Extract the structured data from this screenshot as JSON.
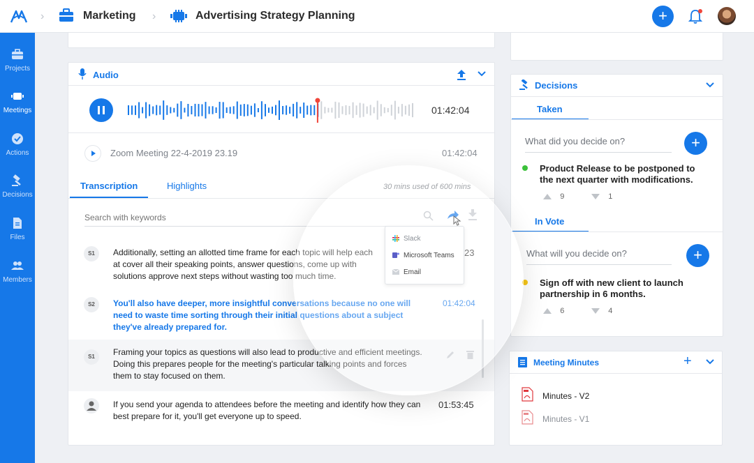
{
  "breadcrumb": {
    "item1": "Marketing",
    "item2": "Advertising Strategy Planning"
  },
  "sidebar": {
    "items": [
      {
        "label": "Projects",
        "icon": "briefcase-icon"
      },
      {
        "label": "Meetings",
        "icon": "meeting-icon"
      },
      {
        "label": "Actions",
        "icon": "check-circle-icon"
      },
      {
        "label": "Decisions",
        "icon": "gavel-icon"
      },
      {
        "label": "Files",
        "icon": "file-icon"
      },
      {
        "label": "Members",
        "icon": "members-icon"
      }
    ]
  },
  "audio": {
    "title": "Audio",
    "duration": "01:42:04",
    "recording": {
      "name": "Zoom Meeting 22-4-2019 23.19",
      "time": "01:42:04"
    },
    "progress": 0.66
  },
  "transcription": {
    "tabs": [
      "Transcription",
      "Highlights"
    ],
    "usage": "30 mins used of 600 mins",
    "search_placeholder": "Search with keywords",
    "share_options": [
      "Slack",
      "Microsoft Teams",
      "Email"
    ],
    "entries": [
      {
        "speaker": "S1",
        "text": "Additionally, setting an allotted time frame for each topic will help each at cover all their speaking points, answer questions, come up with solutions approve next steps without wasting too much time.",
        "time": "23"
      },
      {
        "speaker": "S2",
        "text": "You'll also have deeper, more insightful conversations because no one will need to waste time sorting through their initial questions about a subject they've already prepared for.",
        "time": "01:42:04"
      },
      {
        "speaker": "S1",
        "text": "Framing your topics as questions will also lead to productive and efficient meetings. Doing this prepares people for the meeting's particular talking points and forces them to stay focused on them.",
        "time": ""
      },
      {
        "speaker": "",
        "text": "If you send your agenda to attendees before the meeting and identify how they can best prepare for it, you'll get everyone up to speed.",
        "time": "01:53:45"
      }
    ]
  },
  "decisions": {
    "title": "Decisions",
    "taken_tab": "Taken",
    "taken_placeholder": "What did you decide on?",
    "taken_item": {
      "text": "Product Release to be postponed to the next quarter with modifications.",
      "up": "9",
      "down": "1",
      "dot_color": "#3cc13b"
    },
    "vote_tab": "In Vote",
    "vote_placeholder": "What will you decide on?",
    "vote_item": {
      "text": "Sign off with new client to launch partnership in 6 months.",
      "up": "6",
      "down": "4",
      "dot_color": "#f5c518"
    }
  },
  "minutes": {
    "title": "Meeting Minutes",
    "files": [
      "Minutes - V2",
      "Minutes - V1"
    ]
  },
  "colors": {
    "accent": "#1678e8",
    "sidebar": "#1678e8",
    "progress_marker": "#f0463a"
  }
}
